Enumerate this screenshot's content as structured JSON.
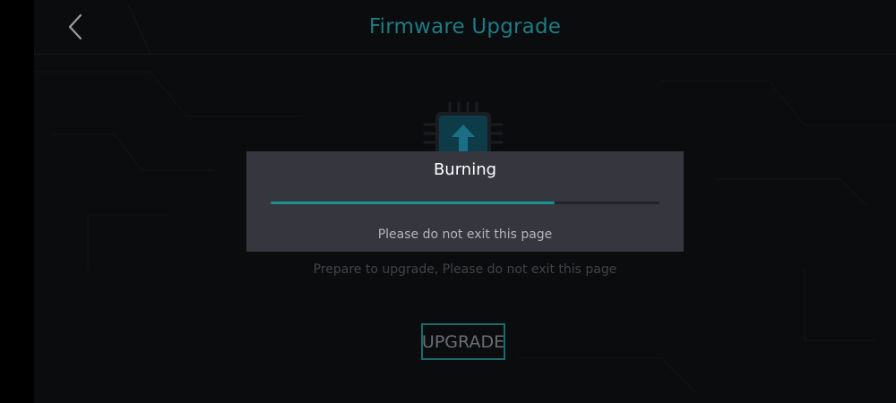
{
  "header": {
    "title": "Firmware Upgrade",
    "back_icon": "chevron-left-icon"
  },
  "main": {
    "chip_icon": "chip-upload-icon",
    "prepare_text": "Prepare to upgrade, Please do not exit this page",
    "upgrade_label": "UPGRADE"
  },
  "dialog": {
    "title": "Burning",
    "progress": 0.73,
    "message": "Please do not exit this page"
  },
  "colors": {
    "accent": "#1e7b84",
    "progress": "#18958c",
    "dialog_bg": "#36363f",
    "background": "#0b0c0e"
  }
}
